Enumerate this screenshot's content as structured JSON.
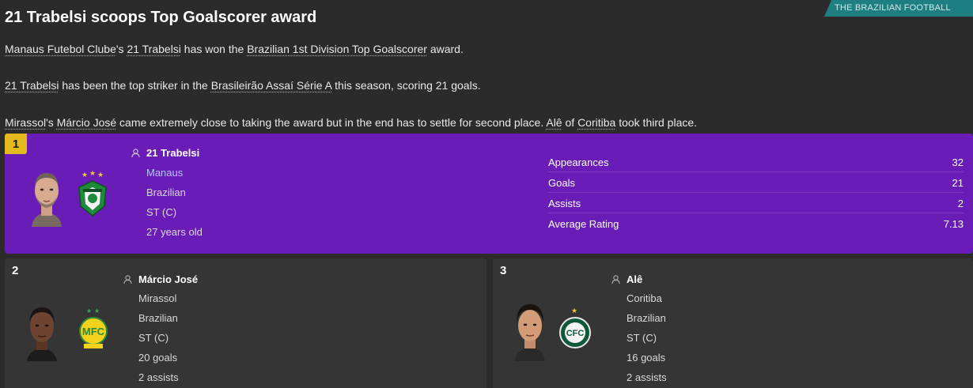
{
  "source": "THE BRAZILIAN FOOTBALL DAILY",
  "headline": "21 Trabelsi scoops Top Goalscorer award",
  "para1": {
    "club": "Manaus Futebol Clube",
    "t1": "'s ",
    "player": "21 Trabelsi",
    "t2": " has won the ",
    "award": "Brazilian 1st Division Top Goalscorer",
    "t3": " award."
  },
  "para2": {
    "player": "21 Trabelsi",
    "t1": " has been the top striker in the ",
    "competition": "Brasileirão Assaí Série A",
    "t2": " this season, scoring 21 goals."
  },
  "para3": {
    "club1": "Mirassol",
    "t1": "'s ",
    "player1": "Márcio José",
    "t2": " came extremely close to taking the award but in the end has to settle for second place. ",
    "player2": "Alê",
    "t3": " of ",
    "club2": "Coritiba",
    "t4": " took third place."
  },
  "winner": {
    "rank": "1",
    "name": "21 Trabelsi",
    "club": "Manaus",
    "nationality": "Brazilian",
    "position": "ST (C)",
    "age": "27 years old",
    "stats": [
      {
        "label": "Appearances",
        "value": "32"
      },
      {
        "label": "Goals",
        "value": "21"
      },
      {
        "label": "Assists",
        "value": "2"
      },
      {
        "label": "Average Rating",
        "value": "7.13"
      }
    ]
  },
  "second": {
    "rank": "2",
    "name": "Márcio José",
    "club": "Mirassol",
    "nationality": "Brazilian",
    "position": "ST (C)",
    "goals": "20 goals",
    "assists": "2 assists"
  },
  "third": {
    "rank": "3",
    "name": "Alê",
    "club": "Coritiba",
    "nationality": "Brazilian",
    "position": "ST (C)",
    "goals": "16 goals",
    "assists": "2 assists"
  },
  "colors": {
    "winner_card": "#6a1db6",
    "gold_badge": "#e3b91e",
    "source_tab": "#1e7f82",
    "background": "#2b2b2b"
  }
}
